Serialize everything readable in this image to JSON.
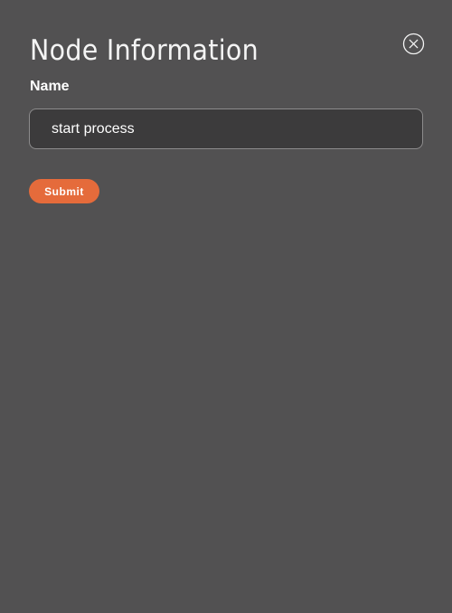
{
  "panel": {
    "title": "Node Information",
    "close_icon": "close-circle-icon"
  },
  "form": {
    "name_label": "Name",
    "name_value": "start process",
    "submit_label": "Submit"
  },
  "colors": {
    "background": "#525152",
    "input_background": "#3c3b3c",
    "input_border": "#8c8b8c",
    "accent": "#e56b3b",
    "text": "#ffffff"
  }
}
